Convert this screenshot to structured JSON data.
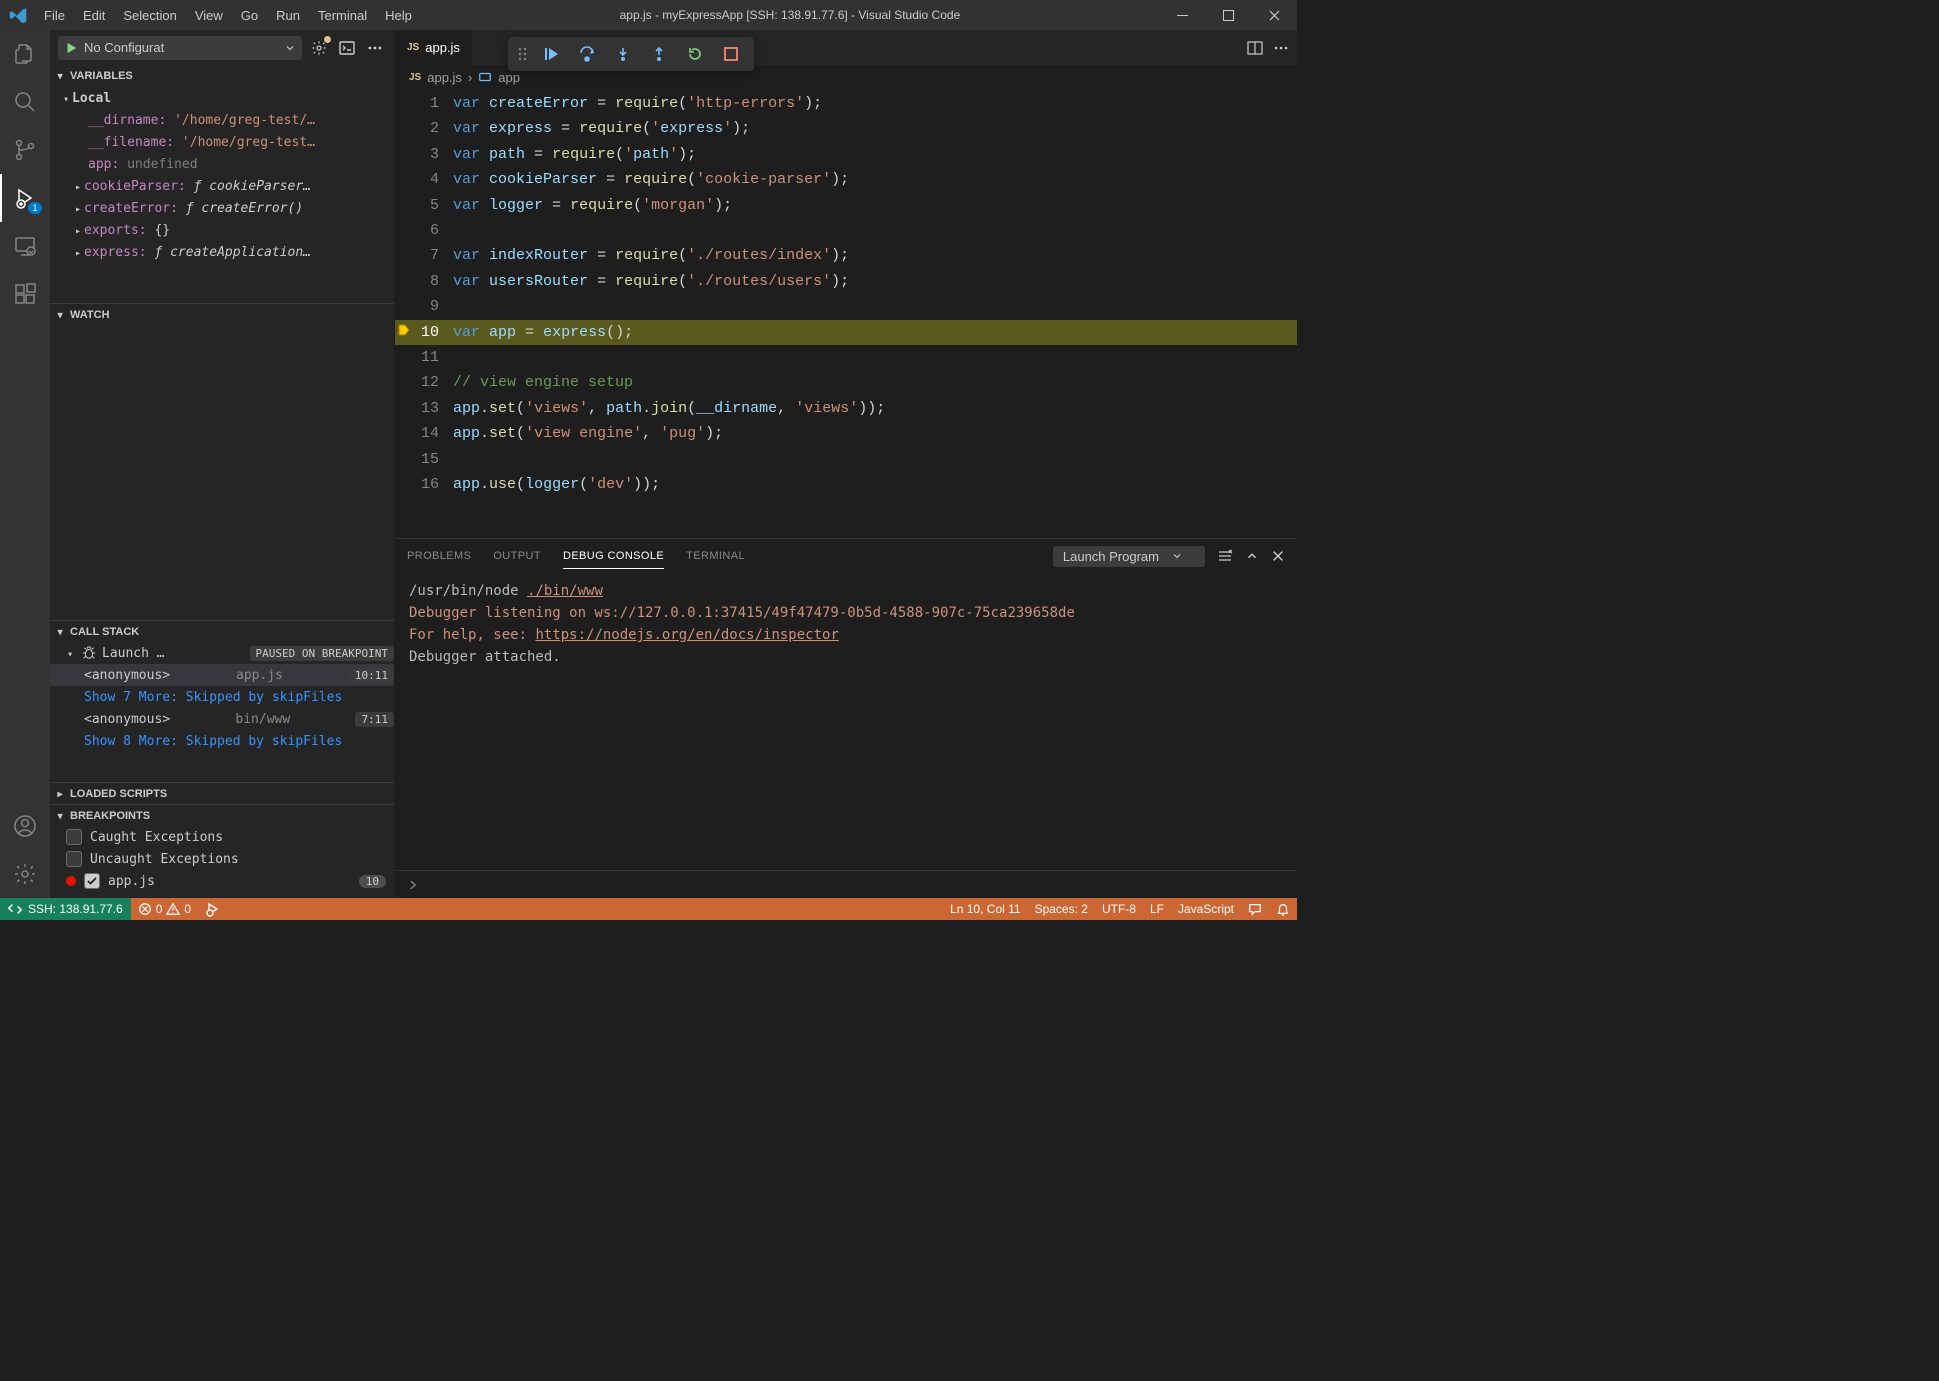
{
  "window": {
    "title": "app.js - myExpressApp [SSH: 138.91.77.6] - Visual Studio Code"
  },
  "menu": [
    "File",
    "Edit",
    "Selection",
    "View",
    "Go",
    "Run",
    "Terminal",
    "Help"
  ],
  "activity": {
    "debug_badge": "1"
  },
  "debugConfig": "No Configurat",
  "sidebar": {
    "variables": {
      "title": "Variables",
      "scope": "Local",
      "items": [
        {
          "name": "__dirname:",
          "value": "'/home/greg-test/…"
        },
        {
          "name": "__filename:",
          "value": "'/home/greg-test…"
        },
        {
          "name": "app:",
          "value": "undefined",
          "undef": true
        },
        {
          "name": "cookieParser:",
          "value": "ƒ cookieParser…",
          "func": true,
          "exp": true
        },
        {
          "name": "createError:",
          "value": "ƒ createError()",
          "func": true,
          "exp": true
        },
        {
          "name": "exports:",
          "value": "{}",
          "exp": true
        },
        {
          "name": "express:",
          "value": "ƒ createApplication…",
          "func": true,
          "exp": true
        }
      ]
    },
    "watch": {
      "title": "Watch"
    },
    "callstack": {
      "title": "Call Stack",
      "session": "Launch …",
      "state": "PAUSED ON BREAKPOINT",
      "frames": [
        {
          "name": "<anonymous>",
          "src": "app.js",
          "pos": "10:11"
        },
        {
          "link": "Show 7 More: Skipped by skipFiles"
        },
        {
          "name": "<anonymous>",
          "src": "bin/www",
          "pos": "7:11"
        },
        {
          "link": "Show 8 More: Skipped by skipFiles"
        }
      ]
    },
    "loaded": {
      "title": "Loaded Scripts"
    },
    "breakpoints": {
      "title": "Breakpoints",
      "caught": "Caught Exceptions",
      "uncaught": "Uncaught Exceptions",
      "file": "app.js",
      "count": "10"
    }
  },
  "tabs": {
    "active": "app.js"
  },
  "breadcrumb": {
    "file": "app.js",
    "symbol": "app"
  },
  "editor": {
    "lines": [
      "var createError = require('http-errors');",
      "var express = require('express');",
      "var path = require('path');",
      "var cookieParser = require('cookie-parser');",
      "var logger = require('morgan');",
      "",
      "var indexRouter = require('./routes/index');",
      "var usersRouter = require('./routes/users');",
      "",
      "var app = express();",
      "",
      "// view engine setup",
      "app.set('views', path.join(__dirname, 'views'));",
      "app.set('view engine', 'pug');",
      "",
      "app.use(logger('dev'));"
    ],
    "current_line": 10
  },
  "panel": {
    "tabs": [
      "Problems",
      "Output",
      "Debug Console",
      "Terminal"
    ],
    "active": "Debug Console",
    "launch": "Launch Program",
    "console": {
      "l1a": "/usr/bin/node ",
      "l1b": "./bin/www",
      "l2": "Debugger listening on ws://127.0.0.1:37415/49f47479-0b5d-4588-907c-75ca239658de",
      "l3a": "For help, see: ",
      "l3b": "https://nodejs.org/en/docs/inspector",
      "l4": "Debugger attached."
    }
  },
  "status": {
    "remote": "SSH: 138.91.77.6",
    "errors": "0",
    "warnings": "0",
    "lncol": "Ln 10, Col 11",
    "spaces": "Spaces: 2",
    "encoding": "UTF-8",
    "eol": "LF",
    "lang": "JavaScript"
  }
}
